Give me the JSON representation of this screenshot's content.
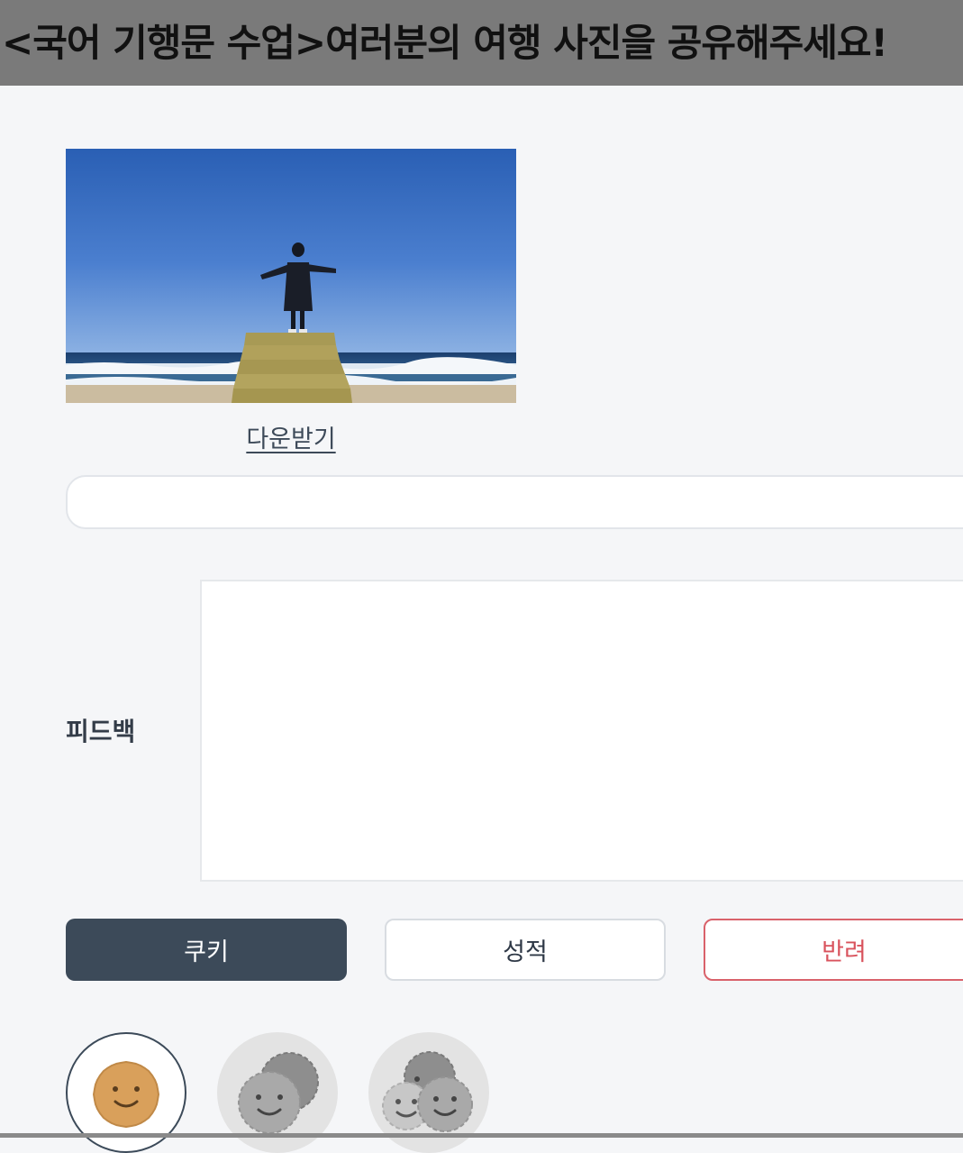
{
  "header": {
    "title": "<국어 기행문 수업>여러분의 여행 사진을 공유해주세요!"
  },
  "post": {
    "photo_alt": "",
    "download_label": "다운받기"
  },
  "comment": {
    "value": "",
    "placeholder": ""
  },
  "feedback": {
    "label": "피드백",
    "value": ""
  },
  "actions": {
    "cookie_label": "쿠키",
    "grade_label": "성적",
    "reject_label": "반려"
  },
  "cookie_options": [
    {
      "name": "single-cookie",
      "selected": true
    },
    {
      "name": "double-cookie",
      "selected": false
    },
    {
      "name": "triple-cookie",
      "selected": false
    }
  ],
  "colors": {
    "primary": "#3c4a59",
    "danger": "#d9535d",
    "header_bg": "#7a7a7a",
    "page_bg": "#f5f6f8",
    "cookie_orange": "#d9a05b"
  }
}
